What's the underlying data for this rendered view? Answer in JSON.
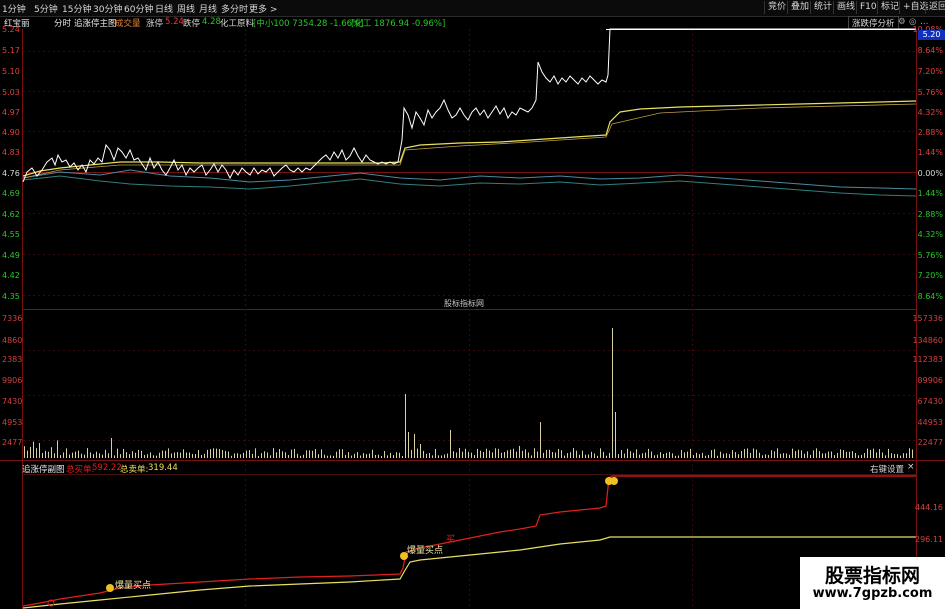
{
  "toolbar": {
    "periods": [
      "1分钟",
      "5分钟",
      "15分钟",
      "30分钟",
      "60分钟",
      "日线",
      "周线",
      "月线",
      "多分时",
      "更多 >"
    ],
    "right_buttons": [
      "竞价",
      "叠加",
      "统计",
      "画线",
      "F10",
      "标记",
      "+自选",
      "返回"
    ]
  },
  "info": {
    "stock_name": "红宝丽",
    "mode": "分时",
    "indicator": "追涨停主图",
    "volume_label": "成交量",
    "limit_up_label": "涨停",
    "limit_up_value": "5.24",
    "limit_down_label": "跌停",
    "limit_down_value": "4.28",
    "sector_label": "化工原料",
    "index_small": "[中小100 7354.28 -1.66%]",
    "index_chem": "[化工 1876.94 -0.96%]",
    "analysis_button": "涨跌停分析"
  },
  "price_axis": {
    "left": [
      "5.24",
      "5.17",
      "5.10",
      "5.03",
      "4.97",
      "4.90",
      "4.83",
      "4.76",
      "4.69",
      "4.62",
      "4.55",
      "4.49",
      "4.42",
      "4.35"
    ],
    "right": [
      "10.08%",
      "8.64%",
      "7.20%",
      "5.76%",
      "4.32%",
      "2.88%",
      "1.44%",
      "0.00%",
      "1.44%",
      "2.88%",
      "4.32%",
      "5.76%",
      "7.20%",
      "8.64%"
    ],
    "current_price_tag": "5.20"
  },
  "volume_axis": {
    "left": [
      "7336",
      "4860",
      "2383",
      "9906",
      "7430",
      "4953",
      "2477"
    ],
    "right": [
      "157336",
      "134860",
      "112383",
      "89906",
      "67430",
      "44953",
      "22477"
    ]
  },
  "watermark": "股标指标网",
  "sub_panel": {
    "title": "追涨停副图",
    "total_buy_label": "总买单:",
    "total_buy_value": "592.22",
    "total_sell_label": "总卖单:",
    "total_sell_value": "319.44",
    "settings_button": "右键设置",
    "close_glyph": "×",
    "axis_right": [
      "444.16",
      "296.11"
    ],
    "markers": [
      "爆量买点",
      "爆量买点"
    ],
    "marker_short": "买"
  },
  "site_badge": {
    "name": "股票指标网",
    "url": "www.7gpzb.com"
  },
  "colors": {
    "price_line": "#ffffff",
    "avg_line": "#e8e060",
    "index_line1": "#4a8aa0",
    "index_line2": "#2f7f7f",
    "buy_line": "#e02020",
    "sell_line": "#e8e060",
    "up": "#e04040",
    "down": "#28c828",
    "volume_bar": "#d8d0a0"
  }
}
